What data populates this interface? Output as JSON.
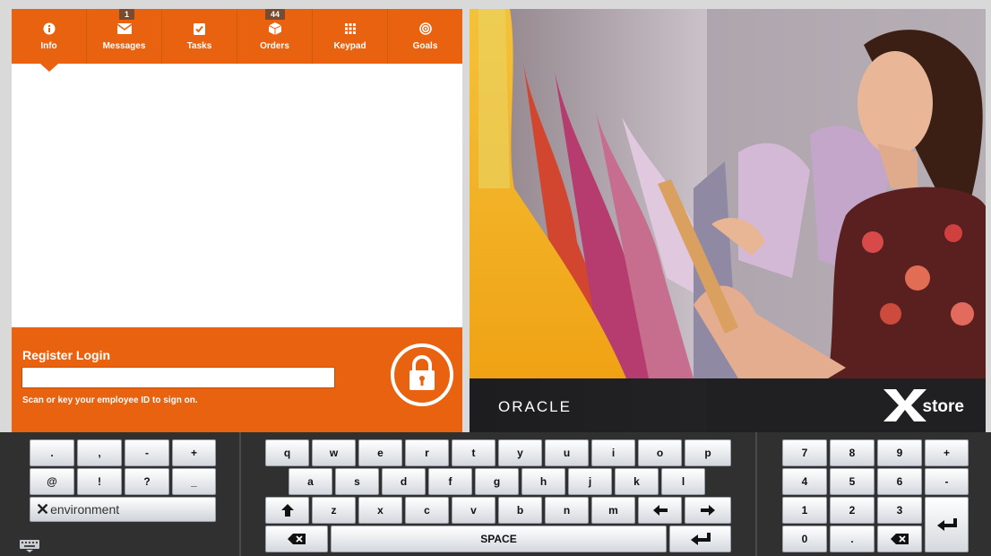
{
  "tabs": [
    {
      "label": "Info",
      "icon": "info-icon",
      "badge": ""
    },
    {
      "label": "Messages",
      "icon": "envelope-icon",
      "badge": "1"
    },
    {
      "label": "Tasks",
      "icon": "checkbox-icon",
      "badge": ""
    },
    {
      "label": "Orders",
      "icon": "box-icon",
      "badge": "44"
    },
    {
      "label": "Keypad",
      "icon": "keypad-icon",
      "badge": ""
    },
    {
      "label": "Goals",
      "icon": "target-icon",
      "badge": ""
    }
  ],
  "login": {
    "title": "Register Login",
    "input_value": "",
    "hint": "Scan or key your employee ID to sign on."
  },
  "brand": {
    "oracle": "ORACLE",
    "xstore": "store",
    "environment": "environment"
  },
  "colors": {
    "accent": "#e8620f",
    "keyboard_bg": "#303030"
  },
  "keyboard": {
    "symbols": [
      [
        ".",
        ",",
        "-",
        "+"
      ],
      [
        "@",
        "!",
        "?",
        "_"
      ]
    ],
    "row1": [
      "q",
      "w",
      "e",
      "r",
      "t",
      "y",
      "u",
      "i",
      "o",
      "p"
    ],
    "row2": [
      "a",
      "s",
      "d",
      "f",
      "g",
      "h",
      "j",
      "k",
      "l"
    ],
    "row3": [
      "z",
      "x",
      "c",
      "v",
      "b",
      "n",
      "m"
    ],
    "space": "SPACE",
    "numpad": [
      [
        "7",
        "8",
        "9",
        "+"
      ],
      [
        "4",
        "5",
        "6",
        "-"
      ],
      [
        "1",
        "2",
        "3"
      ],
      [
        "0",
        "."
      ]
    ]
  }
}
